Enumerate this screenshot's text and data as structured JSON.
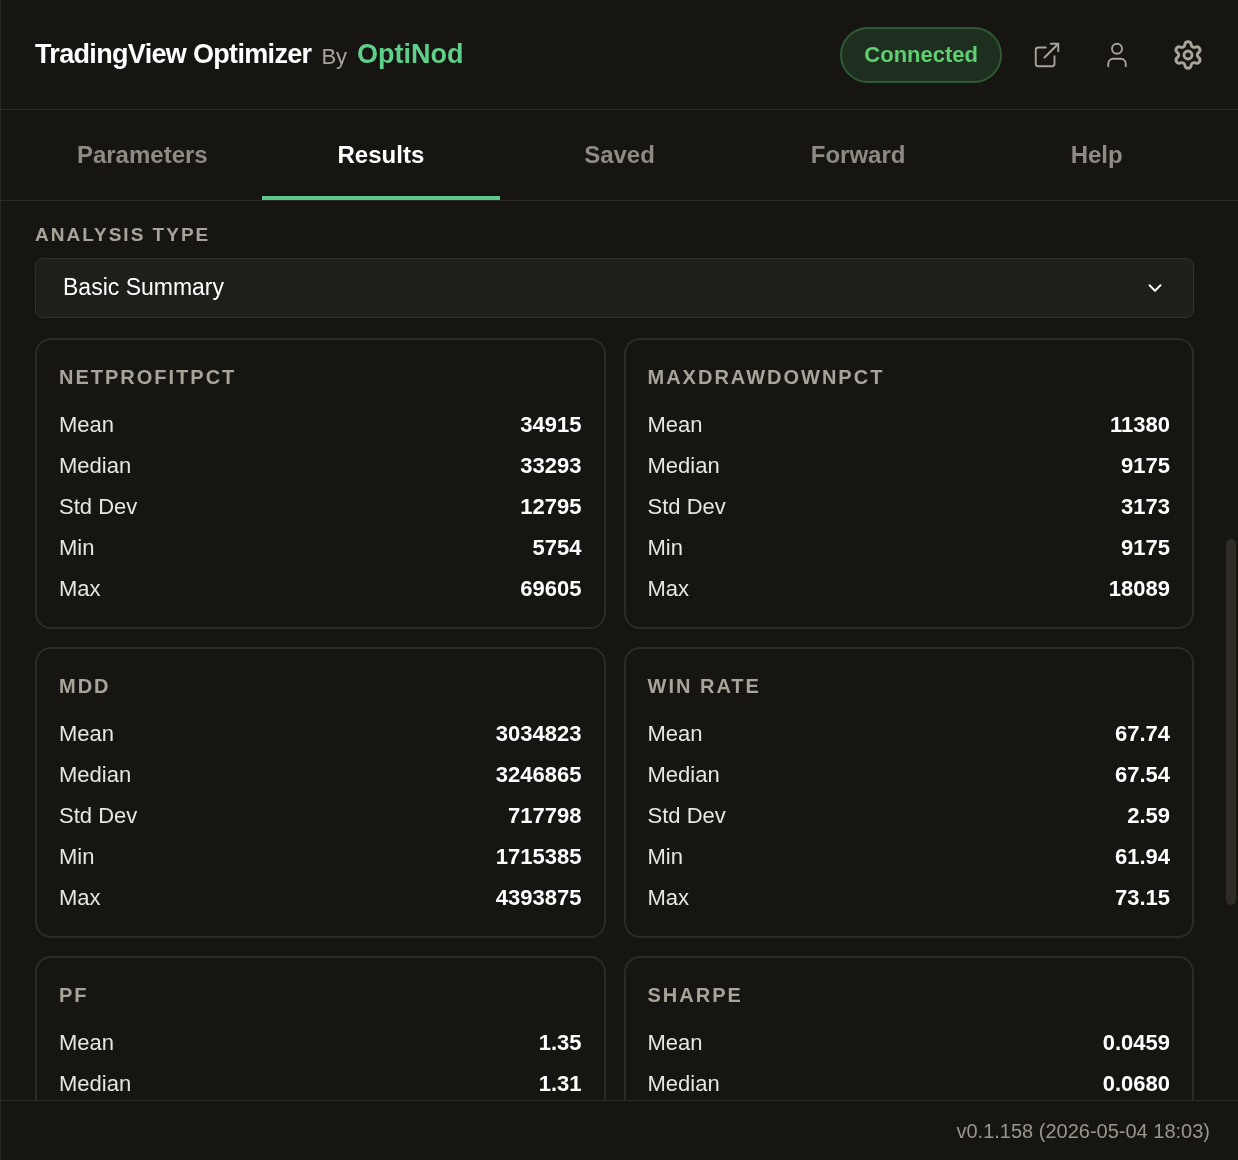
{
  "header": {
    "title": "TradingView Optimizer",
    "by": "By",
    "brand": "OptiNod",
    "status": {
      "label": "Connected",
      "connected": true
    }
  },
  "tabs": [
    {
      "label": "Parameters",
      "selected": false
    },
    {
      "label": "Results",
      "selected": true
    },
    {
      "label": "Saved",
      "selected": false
    },
    {
      "label": "Forward",
      "selected": false
    },
    {
      "label": "Help",
      "selected": false
    }
  ],
  "analysis": {
    "label": "ANALYSIS TYPE",
    "value": "Basic Summary"
  },
  "cards": [
    {
      "title": "NETPROFITPCT",
      "rows": [
        [
          "Mean",
          "34915"
        ],
        [
          "Median",
          "33293"
        ],
        [
          "Std Dev",
          "12795"
        ],
        [
          "Min",
          "5754"
        ],
        [
          "Max",
          "69605"
        ]
      ]
    },
    {
      "title": "MAXDRAWDOWNPCT",
      "rows": [
        [
          "Mean",
          "11380"
        ],
        [
          "Median",
          "9175"
        ],
        [
          "Std Dev",
          "3173"
        ],
        [
          "Min",
          "9175"
        ],
        [
          "Max",
          "18089"
        ]
      ]
    },
    {
      "title": "MDD",
      "rows": [
        [
          "Mean",
          "3034823"
        ],
        [
          "Median",
          "3246865"
        ],
        [
          "Std Dev",
          "717798"
        ],
        [
          "Min",
          "1715385"
        ],
        [
          "Max",
          "4393875"
        ]
      ]
    },
    {
      "title": "WIN RATE",
      "rows": [
        [
          "Mean",
          "67.74"
        ],
        [
          "Median",
          "67.54"
        ],
        [
          "Std Dev",
          "2.59"
        ],
        [
          "Min",
          "61.94"
        ],
        [
          "Max",
          "73.15"
        ]
      ]
    },
    {
      "title": "PF",
      "rows": [
        [
          "Mean",
          "1.35"
        ],
        [
          "Median",
          "1.31"
        ]
      ]
    },
    {
      "title": "SHARPE",
      "rows": [
        [
          "Mean",
          "0.0459"
        ],
        [
          "Median",
          "0.0680"
        ]
      ]
    }
  ],
  "footer": {
    "version": "v0.1.158 (2026-05-04 18:03)"
  }
}
